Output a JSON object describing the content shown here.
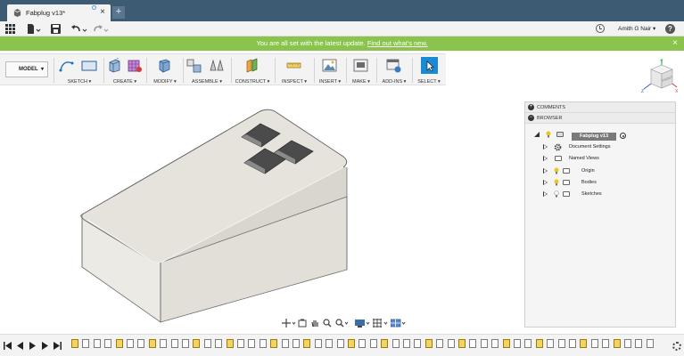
{
  "window": {
    "tab_title": "Fabplug v13*",
    "new_tab": "+"
  },
  "app_toolbar": {
    "user_name": "Amith G Nair ▾",
    "help": "?"
  },
  "banner": {
    "text": "You are all set with the latest update. ",
    "link": "Find out what's new.",
    "close": "×"
  },
  "ribbon": {
    "workspace": "MODEL",
    "groups": [
      {
        "label": "SKETCH ▾"
      },
      {
        "label": "CREATE ▾"
      },
      {
        "label": "MODIFY ▾"
      },
      {
        "label": "ASSEMBLE ▾"
      },
      {
        "label": "CONSTRUCT ▾"
      },
      {
        "label": "INSPECT ▾"
      },
      {
        "label": "INSERT ▾"
      },
      {
        "label": "MAKE ▾"
      },
      {
        "label": "ADD-INS ▾"
      },
      {
        "label": "SELECT ▾"
      }
    ]
  },
  "viewcube": {
    "face": "FRONT",
    "axis_x": "X",
    "axis_y": "Y",
    "axis_z": "Z"
  },
  "panels": {
    "comments": "COMMENTS",
    "browser": "BROWSER",
    "root": "Fabplug v13",
    "items": [
      {
        "label": "Document Settings",
        "icon": "gear-icon"
      },
      {
        "label": "Named Views",
        "icon": "folder-icon"
      },
      {
        "label": "Origin",
        "icon": "folder-icon"
      },
      {
        "label": "Bodies",
        "icon": "folder-icon"
      },
      {
        "label": "Sketches",
        "icon": "folder-icon"
      }
    ]
  },
  "colors": {
    "titlebar": "#3e5b74",
    "banner": "#8ac44d",
    "body_face": "#e6e3dc",
    "select_accent": "#1b8ad4"
  }
}
